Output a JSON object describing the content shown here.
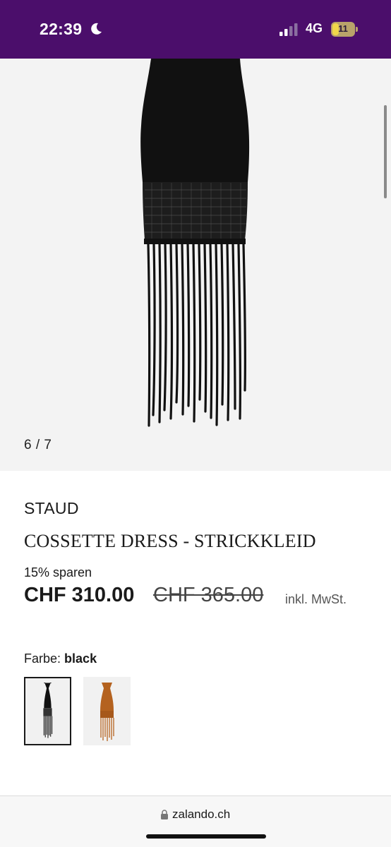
{
  "status_bar": {
    "time": "22:39",
    "network": "4G",
    "battery_level": "11",
    "icons": [
      "moon-icon",
      "signal-icon",
      "battery-icon"
    ]
  },
  "gallery": {
    "counter": "6 / 7",
    "image": "black-knit-fringe-dress"
  },
  "product": {
    "brand": "STAUD",
    "name": "COSSETTE DRESS - STRICKKLEID",
    "discount": "15% sparen",
    "price": "CHF 310.00",
    "original_price": "CHF 365.00",
    "tax_note": "inkl. MwSt."
  },
  "color": {
    "label": "Farbe:",
    "selected": "black",
    "options": [
      "black",
      "brown"
    ]
  },
  "browser": {
    "url": "zalando.ch"
  },
  "colors": {
    "status_bar_bg": "#4b0e6b",
    "gallery_bg": "#f3f3f3",
    "text": "#1a1a1a"
  }
}
